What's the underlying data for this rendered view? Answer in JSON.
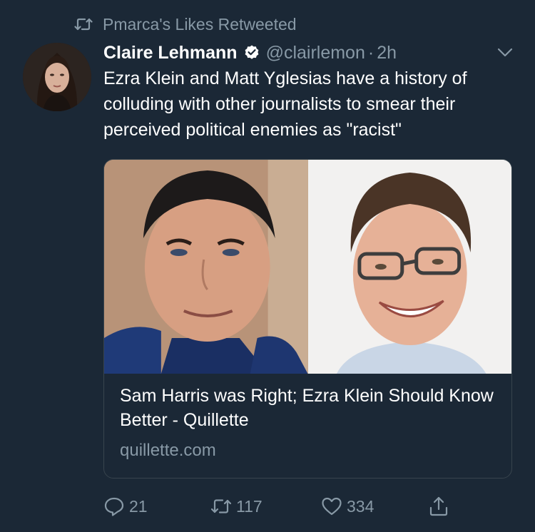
{
  "social_context": {
    "text": "Pmarca's Likes Retweeted",
    "icon": "retweet-icon"
  },
  "author": {
    "display_name": "Claire Lehmann",
    "handle": "@clairlemon",
    "separator": "·",
    "time": "2h",
    "verified": true
  },
  "tweet": {
    "text": "Ezra Klein and Matt Yglesias have a history of colluding with other journalists to smear their perceived political enemies as \"racist\""
  },
  "card": {
    "title": "Sam Harris was Right; Ezra Klein Should Know Better - Quillette",
    "domain": "quillette.com"
  },
  "actions": {
    "reply_count": "21",
    "retweet_count": "117",
    "like_count": "334"
  },
  "colors": {
    "background": "#1b2836",
    "secondary_text": "#8899a6",
    "verified": "#ffffff",
    "border": "#38444d"
  }
}
